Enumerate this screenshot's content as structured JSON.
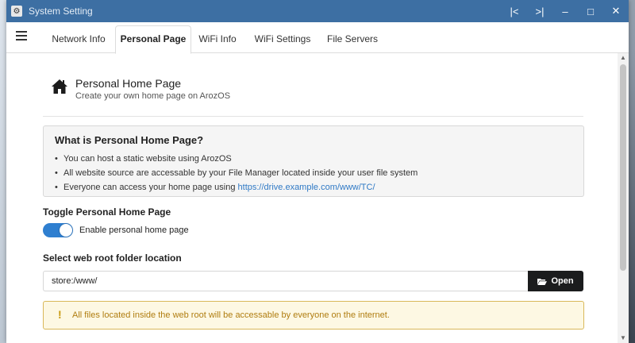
{
  "window": {
    "title": "System Setting",
    "controls": {
      "prev": "|<",
      "next": ">|",
      "minimize": "–",
      "maximize": "□",
      "close": "✕"
    }
  },
  "tabs": [
    {
      "label": "Network Info",
      "active": false
    },
    {
      "label": "Personal Page",
      "active": true
    },
    {
      "label": "WiFi Info",
      "active": false
    },
    {
      "label": "WiFi Settings",
      "active": false
    },
    {
      "label": "File Servers",
      "active": false
    }
  ],
  "header": {
    "title": "Personal Home Page",
    "subtitle": "Create your own home page on ArozOS"
  },
  "info": {
    "title": "What is Personal Home Page?",
    "items": [
      "You can host a static website using ArozOS",
      "All website source are accessable by your File Manager located inside your user file system",
      "Everyone can access your home page using "
    ],
    "link": "https://drive.example.com/www/TC/"
  },
  "toggle_section": {
    "label": "Toggle Personal Home Page",
    "toggle_label": "Enable personal home page",
    "enabled": true
  },
  "root_section": {
    "label": "Select web root folder location",
    "value": "store:/www/",
    "open_button": "Open"
  },
  "warning": {
    "icon": "!",
    "text": "All files located inside the web root will be accessable by everyone on the internet."
  },
  "colors": {
    "titlebar": "#3d6fa3",
    "toggle_on": "#2f7fd0",
    "link": "#2f79c5",
    "warning_bg": "#fdf8e3",
    "warning_text": "#b07d10",
    "open_button_bg": "#1b1c1d"
  }
}
